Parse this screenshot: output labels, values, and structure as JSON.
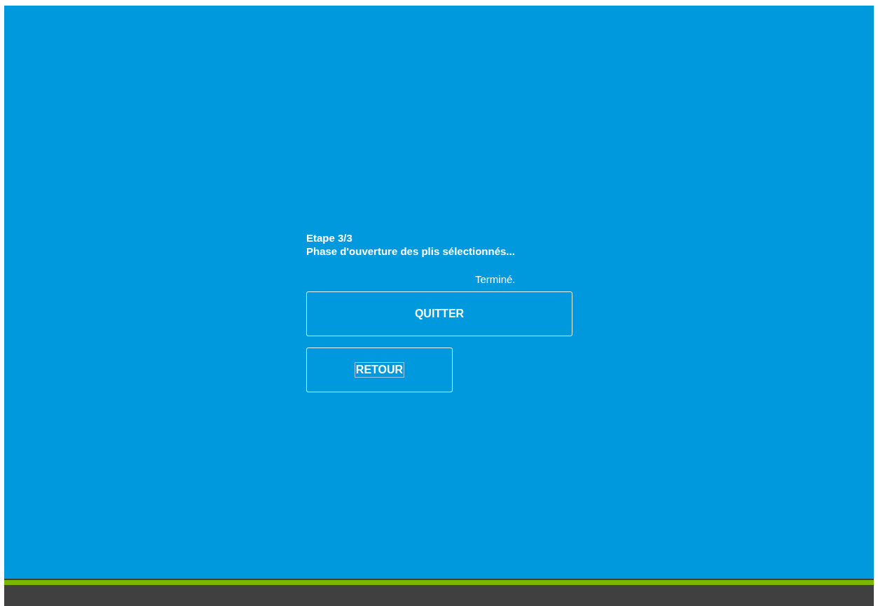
{
  "step": {
    "title": "Etape 3/3",
    "subtitle": "Phase d'ouverture des plis sélectionnés...",
    "status": "Terminé."
  },
  "buttons": [
    {
      "label": "QUITTER",
      "kind": "wide",
      "focused": false
    },
    {
      "label": "RETOUR",
      "kind": "narrow",
      "focused": true
    }
  ],
  "progress": {
    "level": 1
  }
}
